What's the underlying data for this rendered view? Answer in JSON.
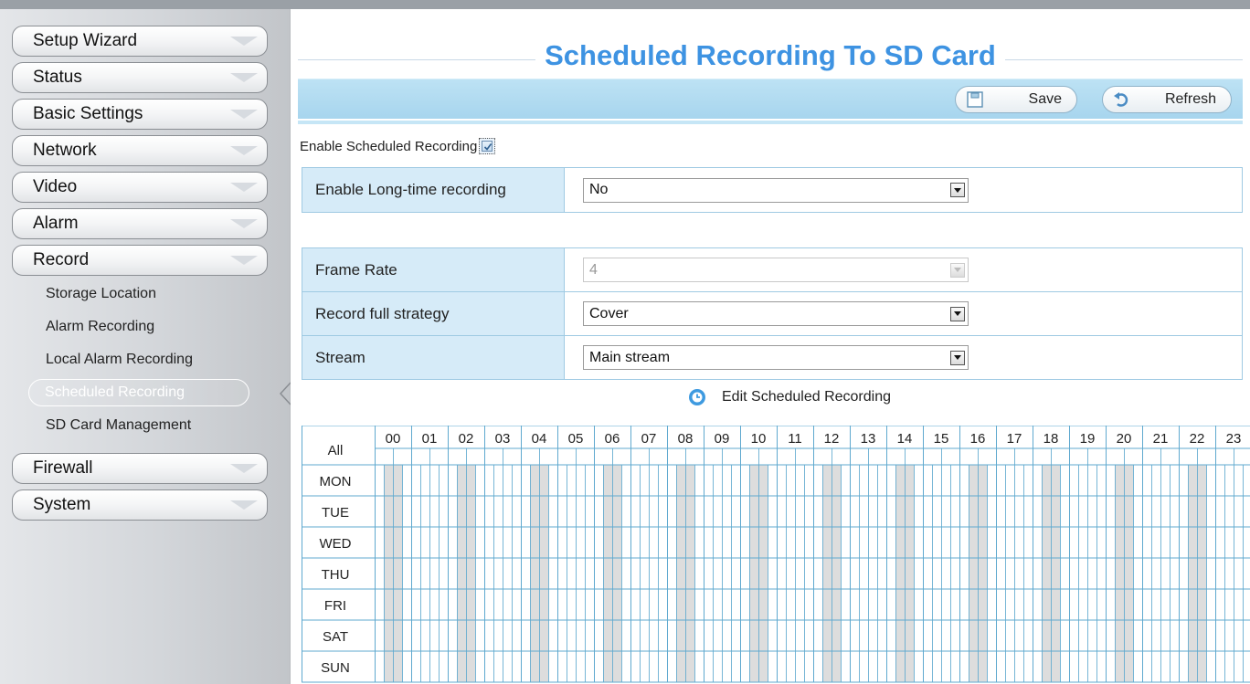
{
  "sidebar": {
    "menu": [
      {
        "label": "Setup Wizard"
      },
      {
        "label": "Status"
      },
      {
        "label": "Basic Settings"
      },
      {
        "label": "Network"
      },
      {
        "label": "Video"
      },
      {
        "label": "Alarm"
      },
      {
        "label": "Record"
      }
    ],
    "record_submenu": [
      {
        "label": "Storage Location"
      },
      {
        "label": "Alarm Recording"
      },
      {
        "label": "Local Alarm Recording"
      },
      {
        "label": "Scheduled Recording",
        "active": true
      },
      {
        "label": "SD Card Management"
      }
    ],
    "menu_after": [
      {
        "label": "Firewall"
      },
      {
        "label": "System"
      }
    ]
  },
  "page": {
    "title": "Scheduled Recording To SD Card",
    "save_label": "Save",
    "refresh_label": "Refresh",
    "enable_label": "Enable Scheduled Recording",
    "enable_checked": true,
    "long_time": {
      "label": "Enable Long-time recording",
      "value": "No"
    },
    "frame_rate": {
      "label": "Frame Rate",
      "value": "4",
      "disabled": true
    },
    "record_full": {
      "label": "Record full strategy",
      "value": "Cover"
    },
    "stream": {
      "label": "Stream",
      "value": "Main stream"
    },
    "edit_label": "Edit Scheduled Recording"
  },
  "schedule": {
    "all_label": "All",
    "hours": [
      "00",
      "01",
      "02",
      "03",
      "04",
      "05",
      "06",
      "07",
      "08",
      "09",
      "10",
      "11",
      "12",
      "13",
      "14",
      "15",
      "16",
      "17",
      "18",
      "19",
      "20",
      "21",
      "22",
      "23"
    ],
    "days": [
      "MON",
      "TUE",
      "WED",
      "THU",
      "FRI",
      "SAT",
      "SUN"
    ]
  },
  "colors": {
    "title": "#3e93e2",
    "grid_line": "#5fa9cf",
    "shaded_cell": "#dddddd",
    "label_bg": "#d6ebf8"
  }
}
